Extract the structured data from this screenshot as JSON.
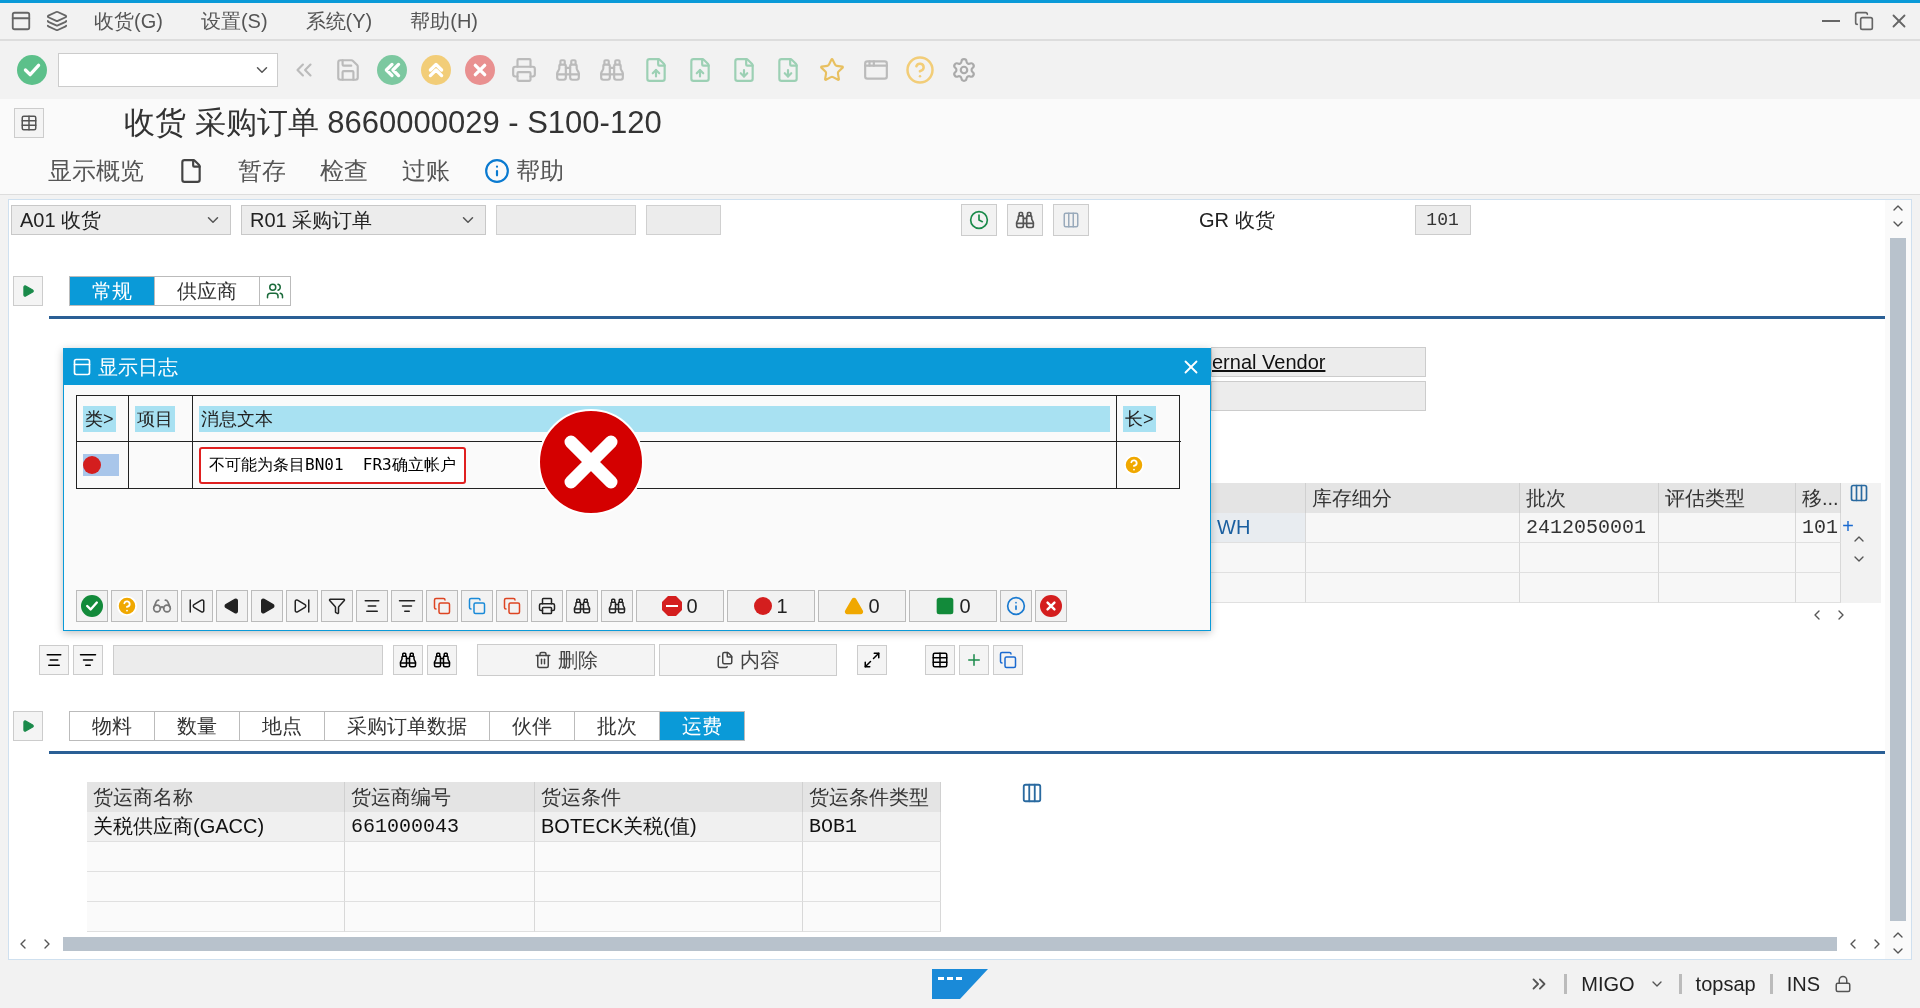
{
  "menu_bar": {
    "items": [
      "收货(G)",
      "设置(S)",
      "系统(Y)",
      "帮助(H)"
    ]
  },
  "title": "收货 采购订单 8660000029 - S100-120",
  "app_toolbar": [
    {
      "kind": "text",
      "label": "显示概览"
    },
    {
      "kind": "document"
    },
    {
      "kind": "text",
      "label": "暂存"
    },
    {
      "kind": "text",
      "label": "检查"
    },
    {
      "kind": "text",
      "label": "过账"
    },
    {
      "kind": "info",
      "label": "帮助"
    }
  ],
  "header": {
    "action": "A01 收货",
    "reference": "R01 采购订单",
    "movement_label": "GR 收货",
    "movement_type": "101"
  },
  "header_tabs": [
    {
      "label": "常规",
      "selected": true
    },
    {
      "label": "供应商",
      "selected": false
    }
  ],
  "vendor_field": "ernal Vendor",
  "items_table": {
    "columns": [
      "库存细分",
      "批次",
      "评估类型",
      "移..."
    ],
    "row": {
      "column_1": "WH",
      "batch": "2412050001",
      "movement_type": "101",
      "marker": "+"
    }
  },
  "dialog": {
    "title": "显示日志",
    "columns": [
      "类>",
      "项目",
      "消息文本",
      "长>"
    ],
    "messages": [
      {
        "kind": "error",
        "text": "不可能为条目BN01  FR3确立帐户",
        "selected": true,
        "highlighted": true
      }
    ],
    "counts": [
      {
        "kind": "stop",
        "value": "0"
      },
      {
        "kind": "error",
        "value": "1"
      },
      {
        "kind": "warning",
        "value": "0"
      },
      {
        "kind": "success",
        "value": "0"
      }
    ]
  },
  "item_toolbar": {
    "buttons": [
      {
        "kind": "delete",
        "label": "删除"
      },
      {
        "kind": "content",
        "label": "内容"
      }
    ]
  },
  "item_tabs": [
    {
      "label": "物料",
      "selected": false
    },
    {
      "label": "数量",
      "selected": false
    },
    {
      "label": "地点",
      "selected": false
    },
    {
      "label": "采购订单数据",
      "selected": false
    },
    {
      "label": "伙伴",
      "selected": false
    },
    {
      "label": "批次",
      "selected": false
    },
    {
      "label": "运费",
      "selected": true
    }
  ],
  "freight_table": {
    "columns": [
      "货运商名称",
      "货运商编号",
      "货运条件",
      "货运条件类型"
    ],
    "rows": [
      [
        "关税供应商(GACC)",
        "661000043",
        "BOTECK关税(值)",
        "BOB1"
      ]
    ]
  },
  "status_bar": {
    "transaction": "MIGO",
    "server": "topsap",
    "mode": "INS"
  }
}
